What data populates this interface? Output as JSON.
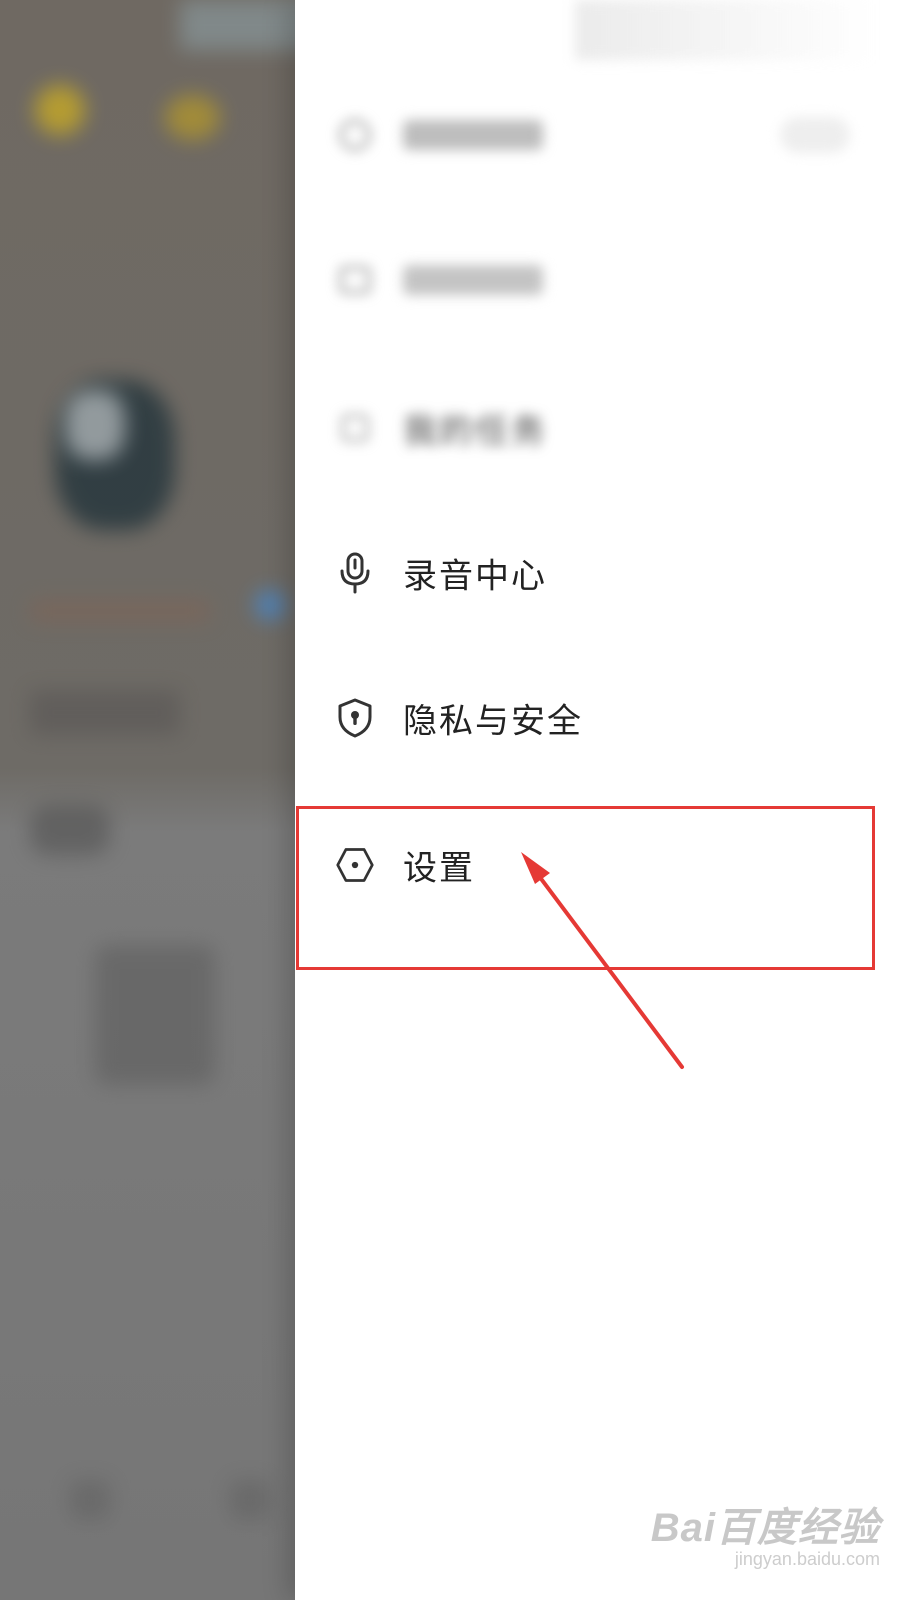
{
  "drawer": {
    "items": [
      {
        "label": "",
        "icon": "blurred-icon",
        "blurred": true
      },
      {
        "label": "",
        "icon": "blurred-icon",
        "blurred": true
      },
      {
        "label": "我的任务",
        "icon": "blurred-icon",
        "blurred": true
      },
      {
        "label": "录音中心",
        "icon": "microphone-icon"
      },
      {
        "label": "隐私与安全",
        "icon": "shield-lock-icon"
      },
      {
        "label": "设置",
        "icon": "hexagon-settings-icon"
      }
    ]
  },
  "annotation": {
    "highlight_color": "#e53935",
    "target": "设置"
  },
  "watermark": {
    "main": "Bai百度经验",
    "sub": "jingyan.baidu.com"
  },
  "colors": {
    "text": "#222222",
    "icon": "#333333",
    "drawer_bg": "#ffffff",
    "overlay_bg": "#6f6962"
  }
}
